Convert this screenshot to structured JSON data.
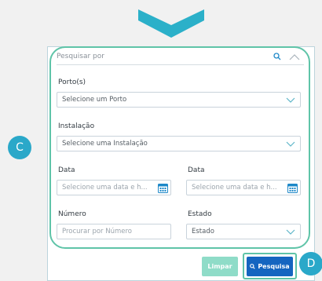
{
  "colors": {
    "accent_teal": "#5fc4a8",
    "marker_blue": "#2aa8c9",
    "primary_blue": "#1565c0",
    "limpar_green": "#8fdcc8"
  },
  "search": {
    "label": "Pesquisar por"
  },
  "fields": {
    "porto": {
      "label": "Porto(s)",
      "value": "Selecione um Porto"
    },
    "instalacao": {
      "label": "Instalação",
      "value": "Selecione uma Instalação"
    },
    "data_inicio": {
      "label": "Data",
      "placeholder": "Selecione uma data e h..."
    },
    "data_fim": {
      "label": "Data",
      "placeholder": "Selecione uma data e h..."
    },
    "numero": {
      "label": "Número",
      "placeholder": "Procurar por Número"
    },
    "estado": {
      "label": "Estado",
      "value": "Estado"
    }
  },
  "buttons": {
    "limpar": "Limpar",
    "pesquisa": "Pesquisa"
  },
  "markers": {
    "c": "C",
    "d": "D"
  },
  "icons": [
    "chevron-down-icon",
    "search-icon",
    "chevron-up-icon",
    "calendar-icon"
  ]
}
